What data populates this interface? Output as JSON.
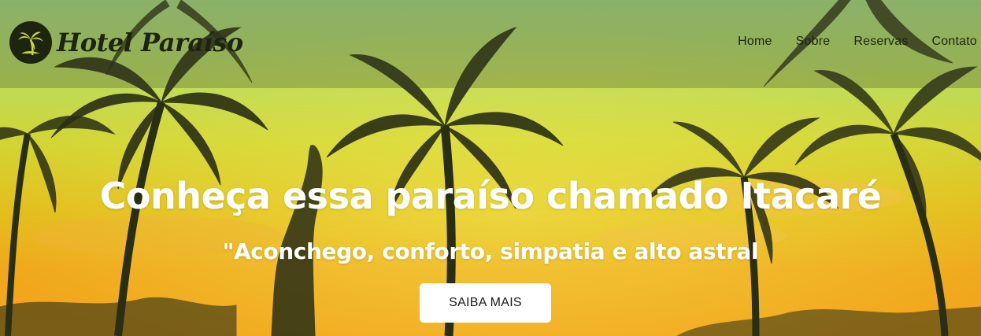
{
  "brand": {
    "name": "Hotel Paraíso",
    "logo_icon": "palm-tree-icon"
  },
  "nav": {
    "items": [
      {
        "label": "Home"
      },
      {
        "label": "Sobre"
      },
      {
        "label": "Reservas"
      },
      {
        "label": "Contato"
      }
    ]
  },
  "hero": {
    "title": "Conheça essa paraíso chamado Itacaré",
    "subtitle": "\"Aconchego, conforto, simpatia e alto astral",
    "cta_label": "SAIBA MAIS",
    "background_image": "tropical-sunset-palm-trees"
  },
  "colors": {
    "sky_top": "#a9dc84",
    "sky_middle": "#d1d534",
    "sky_bottom": "#f3a51c",
    "silhouette": "#1d2410",
    "text": "#ffffff",
    "button_bg": "#ffffff"
  }
}
